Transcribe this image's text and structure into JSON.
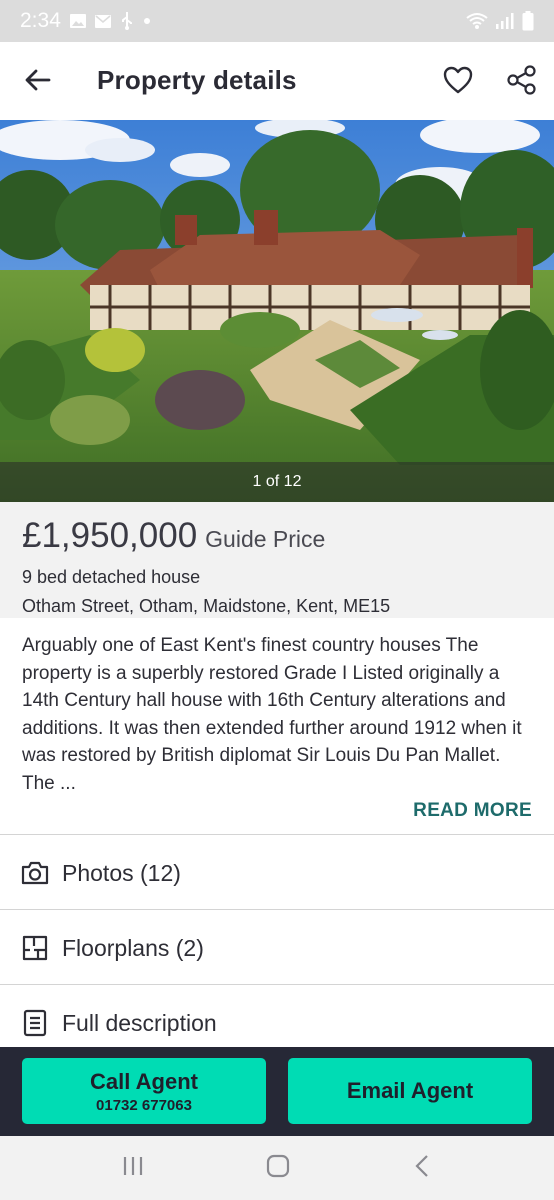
{
  "status_bar": {
    "time": "2:34",
    "left_icons": [
      "image-icon",
      "mail-icon",
      "usb-icon",
      "dot-icon"
    ],
    "right_icons": [
      "wifi-icon",
      "signal-icon",
      "battery-icon"
    ]
  },
  "app_bar": {
    "title": "Property details",
    "back_icon": "arrow-left-icon",
    "favorite_icon": "heart-outline-icon",
    "share_icon": "share-icon"
  },
  "gallery": {
    "counter": "1 of 12"
  },
  "summary": {
    "price": "£1,950,000",
    "price_qualifier": "Guide Price",
    "property_type": "9 bed detached house",
    "address": "Otham Street, Otham, Maidstone, Kent, ME15"
  },
  "description": {
    "text": "Arguably one of East Kent's finest country houses The property is a superbly restored Grade I Listed originally a 14th Century hall house with 16th Century alterations and additions. It was then extended further around 1912 when it was restored by British diplomat Sir Louis Du Pan Mallet. The ...",
    "read_more": "READ MORE"
  },
  "sections": [
    {
      "label": "Photos (12)",
      "icon": "camera-icon"
    },
    {
      "label": "Floorplans (2)",
      "icon": "floorplan-icon"
    },
    {
      "label": "Full description",
      "icon": "document-icon"
    }
  ],
  "actions": {
    "call_label": "Call Agent",
    "call_phone": "01732 677063",
    "email_label": "Email Agent",
    "accent_color": "#00dcb4",
    "bar_color": "#262836"
  },
  "nav_bar": {
    "icons": [
      "recents-icon",
      "home-icon",
      "back-icon"
    ]
  }
}
